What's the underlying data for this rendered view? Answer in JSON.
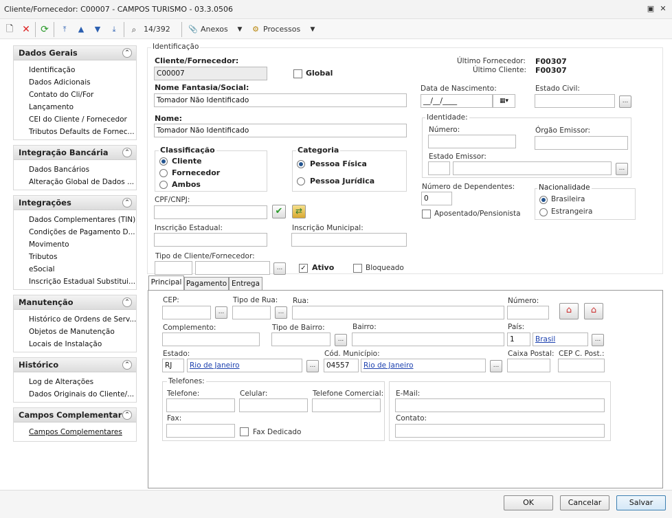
{
  "window": {
    "title": "Cliente/Fornecedor: C00007 - CAMPOS TURISMO - 03.3.0506"
  },
  "toolbar": {
    "counter": "14/392",
    "anexos": "Anexos",
    "processos": "Processos"
  },
  "sidebar": {
    "sections": [
      {
        "title": "Dados Gerais",
        "items": [
          "Identificação",
          "Dados Adicionais",
          "Contato do Cli/For",
          "Lançamento",
          "CEI do Cliente / Fornecedor",
          "Tributos Defaults de Fornec..."
        ]
      },
      {
        "title": "Integração Bancária",
        "items": [
          "Dados Bancários",
          "Alteração Global de Dados ..."
        ]
      },
      {
        "title": "Integrações",
        "items": [
          "Dados Complementares (TIN)",
          "Condições de Pagamento D...",
          "Movimento",
          "Tributos",
          "eSocial",
          "Inscrição Estadual Substitui..."
        ]
      },
      {
        "title": "Manutenção",
        "items": [
          "Histórico de Ordens de Serv...",
          "Objetos de Manutenção",
          "Locais de Instalação"
        ]
      },
      {
        "title": "Histórico",
        "items": [
          "Log de Alterações",
          "Dados Originais do Cliente/..."
        ]
      },
      {
        "title": "Campos Complementares",
        "items": [
          "Campos Complementares"
        ]
      }
    ]
  },
  "identificacao": {
    "legend": "Identificação",
    "cliente_label": "Cliente/Fornecedor:",
    "cliente_value": "C00007",
    "global_label": "Global",
    "ultimo_fornecedor_label": "Último Fornecedor:",
    "ultimo_fornecedor_value": "F00307",
    "ultimo_cliente_label": "Último Cliente:",
    "ultimo_cliente_value": "F00307",
    "fantasia_label": "Nome Fantasia/Social:",
    "fantasia_value": "Tomador Não Identificado",
    "nome_label": "Nome:",
    "nome_value": "Tomador Não Identificado",
    "data_nasc_label": "Data de Nascimento:",
    "data_nasc_value": "__/__/____",
    "estado_civil_label": "Estado Civil:",
    "identidade_label": "Identidade:",
    "numero_label": "Número:",
    "orgao_label": "Órgão Emissor:",
    "estado_emissor_label": "Estado Emissor:",
    "classificacao_label": "Classificação",
    "class_opts": [
      "Cliente",
      "Fornecedor",
      "Ambos"
    ],
    "categoria_label": "Categoria",
    "cat_opts": [
      "Pessoa Física",
      "Pessoa Jurídica"
    ],
    "dependentes_label": "Número de Dependentes:",
    "dependentes_value": "0",
    "aposentado_label": "Aposentado/Pensionista",
    "nacionalidade_label": "Nacionalidade",
    "nac_opts": [
      "Brasileira",
      "Estrangeira"
    ],
    "cpf_label": "CPF/CNPJ:",
    "ie_label": "Inscrição Estadual:",
    "im_label": "Inscrição Municipal:",
    "tipo_label": "Tipo de Cliente/Fornecedor:",
    "ativo_label": "Ativo",
    "bloqueado_label": "Bloqueado"
  },
  "tabs": [
    "Principal",
    "Pagamento",
    "Entrega"
  ],
  "principal": {
    "cep": "CEP:",
    "tipo_rua": "Tipo de Rua:",
    "rua": "Rua:",
    "numero": "Número:",
    "complemento": "Complemento:",
    "tipo_bairro": "Tipo de Bairro:",
    "bairro": "Bairro:",
    "pais": "País:",
    "pais_code": "1",
    "pais_name": "Brasil",
    "estado": "Estado:",
    "estado_code": "RJ",
    "estado_name": "Rio de Janeiro",
    "cod_mun": "Cód. Município:",
    "cod_mun_value": "04557",
    "mun_name": "Rio de Janeiro",
    "caixa_postal": "Caixa Postal:",
    "cep_cpost": "CEP C. Post.:",
    "telefones": "Telefones:",
    "telefone": "Telefone:",
    "celular": "Celular:",
    "tel_comercial": "Telefone Comercial:",
    "fax": "Fax:",
    "fax_dedicado": "Fax Dedicado",
    "email": "E-Mail:",
    "contato": "Contato:"
  },
  "buttons": {
    "ok": "OK",
    "cancelar": "Cancelar",
    "salvar": "Salvar"
  },
  "colors": {
    "accent": "#24548f",
    "link": "#1a3fae"
  }
}
